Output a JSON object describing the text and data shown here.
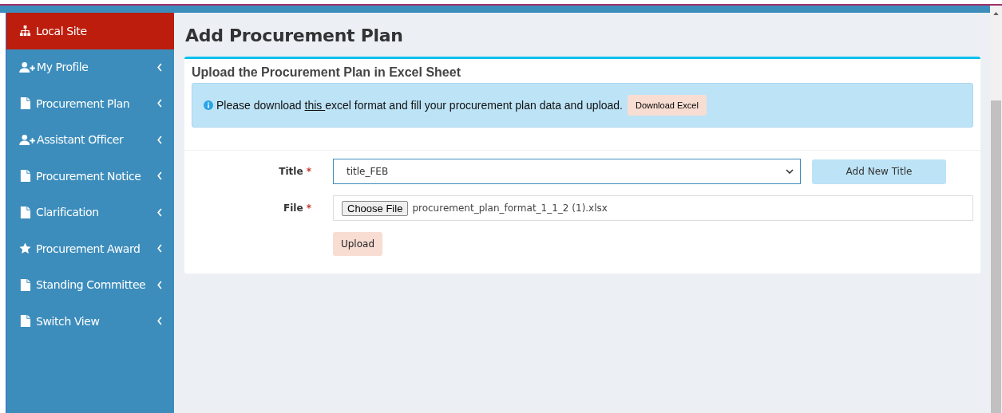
{
  "sidebar": {
    "items": [
      {
        "label": "Local Site",
        "kind": "sitemap",
        "selected": true,
        "has_children": false
      },
      {
        "label": "My Profile",
        "kind": "user-plus",
        "selected": false,
        "has_children": true
      },
      {
        "label": "Procurement Plan",
        "kind": "file",
        "selected": false,
        "has_children": true
      },
      {
        "label": "Assistant Officer",
        "kind": "user-plus",
        "selected": false,
        "has_children": true
      },
      {
        "label": "Procurement Notice",
        "kind": "file",
        "selected": false,
        "has_children": true
      },
      {
        "label": "Clarification",
        "kind": "file",
        "selected": false,
        "has_children": true
      },
      {
        "label": "Procurement Award",
        "kind": "star",
        "selected": false,
        "has_children": true
      },
      {
        "label": "Standing Committee",
        "kind": "file",
        "selected": false,
        "has_children": true
      },
      {
        "label": "Switch View",
        "kind": "file",
        "selected": false,
        "has_children": true
      }
    ]
  },
  "page_title": "Add Procurement Plan",
  "card": {
    "title": "Upload the Procurement Plan in Excel Sheet",
    "notice": {
      "before": "Please download ",
      "link": "this ",
      "after": "excel format and fill your procurement plan data and upload.",
      "button": "Download Excel"
    },
    "form": {
      "title_label": "Title",
      "title_value": "title_FEB",
      "add_button": "Add New Title",
      "file_label": "File",
      "file_button": "Choose File",
      "file_name": "procurement_plan_format_1_1_2 (1).xlsx",
      "required_mark": "*",
      "upload_button": "Upload"
    }
  }
}
